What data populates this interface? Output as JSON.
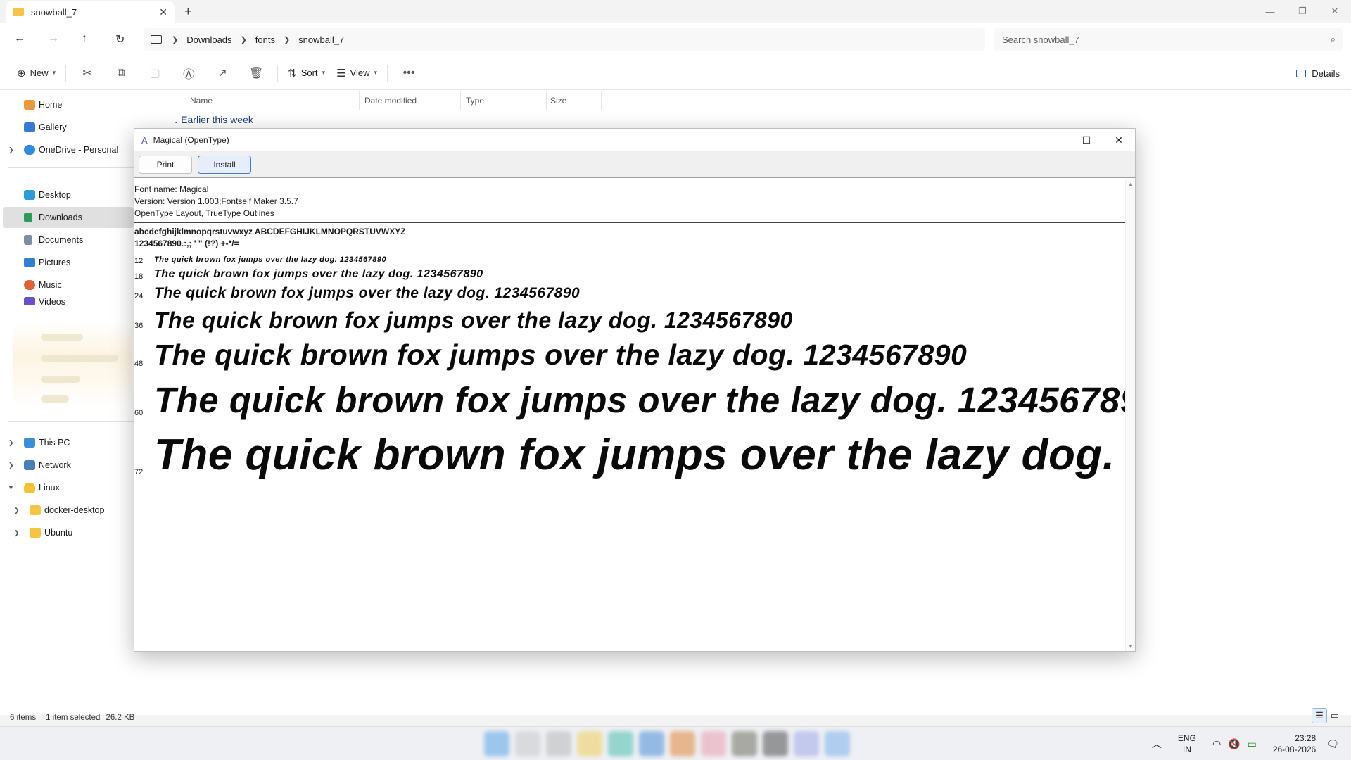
{
  "explorer": {
    "tab_title": "snowball_7",
    "breadcrumbs": [
      "Downloads",
      "fonts",
      "snowball_7"
    ],
    "search_placeholder": "Search snowball_7",
    "commands": {
      "new": "New",
      "sort": "Sort",
      "view": "View",
      "details": "Details"
    },
    "columns": [
      "Name",
      "Date modified",
      "Type",
      "Size"
    ],
    "group_label": "Earlier this week",
    "sidebar": [
      {
        "label": "Home",
        "icon": "home-icon"
      },
      {
        "label": "Gallery",
        "icon": "gallery-icon"
      },
      {
        "label": "OneDrive - Personal",
        "icon": "onedrive-icon"
      },
      {
        "label": "Desktop",
        "icon": "desktop-icon"
      },
      {
        "label": "Downloads",
        "icon": "downloads-icon"
      },
      {
        "label": "Documents",
        "icon": "documents-icon"
      },
      {
        "label": "Pictures",
        "icon": "pictures-icon"
      },
      {
        "label": "Music",
        "icon": "music-icon"
      },
      {
        "label": "Videos",
        "icon": "videos-icon"
      },
      {
        "label": "This PC",
        "icon": "pc-icon"
      },
      {
        "label": "Network",
        "icon": "network-icon"
      },
      {
        "label": "Linux",
        "icon": "linux-icon"
      },
      {
        "label": "docker-desktop",
        "icon": "folder-icon"
      },
      {
        "label": "Ubuntu",
        "icon": "folder-icon"
      }
    ],
    "status": {
      "items": "6 items",
      "selected": "1 item selected",
      "size": "26.2 KB"
    }
  },
  "dialog": {
    "title": "Magical (OpenType)",
    "print_label": "Print",
    "install_label": "Install",
    "font_name": "Font name: Magical",
    "version": "Version: Version 1.003;Fontself Maker 3.5.7",
    "outlines": "OpenType Layout, TrueType Outlines",
    "charset_line1": "abcdefghijklmnopqrstuvwxyz ABCDEFGHIJKLMNOPQRSTUVWXYZ",
    "charset_line2": "1234567890.:,; ' \" (!?) +-*/=",
    "sample_text": "The quick brown fox jumps over the lazy dog. 1234567890",
    "sizes": [
      "12",
      "18",
      "24",
      "36",
      "48",
      "60",
      "72"
    ]
  },
  "taskbar": {
    "lang_top": "ENG",
    "lang_bottom": "IN",
    "time": "23:28",
    "date": "26-08-2026"
  }
}
